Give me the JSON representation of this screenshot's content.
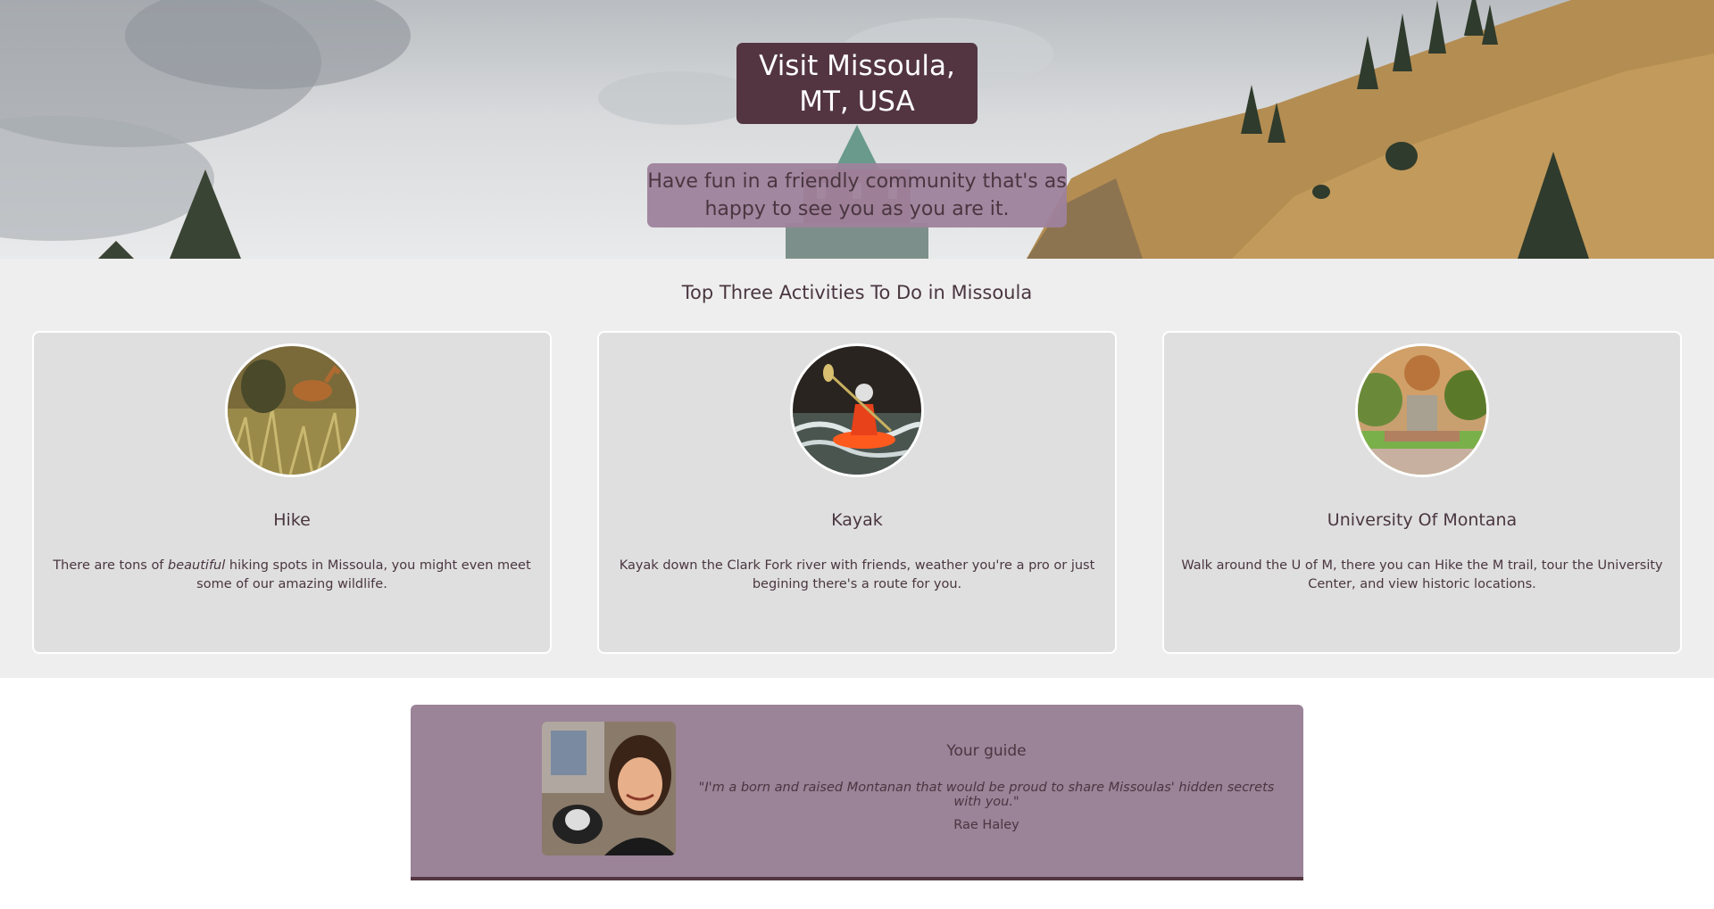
{
  "hero": {
    "title": "Visit Missoula, MT, USA",
    "subtitle": "Have fun in a friendly community that's as happy to see you as you are it."
  },
  "activities": {
    "heading": "Top Three Activities To Do in Missoula",
    "cards": [
      {
        "title": "Hike",
        "text_before": "There are tons of ",
        "text_em": "beautiful",
        "text_after": " hiking spots in Missoula, you might even meet some of our amazing wildlife.",
        "image": "deer-in-grass"
      },
      {
        "title": "Kayak",
        "text": "Kayak down the Clark Fork river with friends, weather you're a pro or just begining there's a route for you.",
        "image": "kayaker-in-rapids"
      },
      {
        "title": "University Of Montana",
        "text": "Walk around the U of M, there you can Hike the M trail, tour the University Center, and view historic locations.",
        "image": "university-campus"
      }
    ]
  },
  "guide": {
    "title": "Your guide",
    "quote": "\"I'm a born and raised Montanan that would be proud to share Missoulas' hidden secrets with you.\"",
    "name": "Rae Haley",
    "image": "guide-portrait"
  },
  "colors": {
    "brand_dark": "#533541",
    "brand_mauve": "#9b8398",
    "text": "#4a3640",
    "section_bg": "#eeeeee",
    "card_bg": "#dfdfdf"
  }
}
